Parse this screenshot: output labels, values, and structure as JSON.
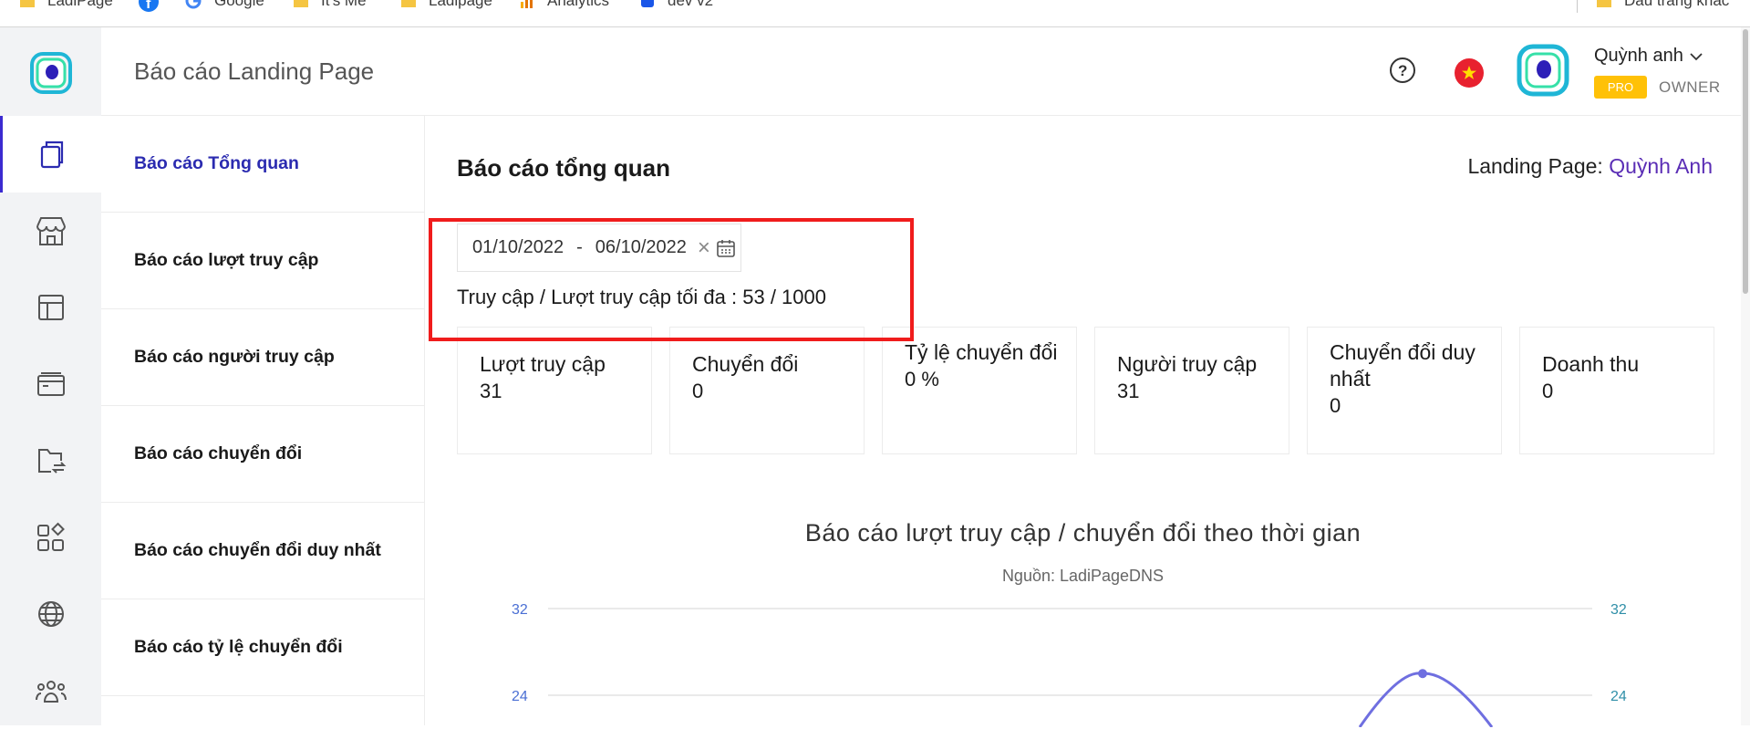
{
  "bookmarks": {
    "items": [
      {
        "label": "LadiPage",
        "icon": "folder-icon"
      },
      {
        "label": "",
        "icon": "facebook-icon"
      },
      {
        "label": "Google",
        "icon": "google-icon"
      },
      {
        "label": "It's Me",
        "icon": "folder-icon"
      },
      {
        "label": "Ladipage",
        "icon": "folder-icon"
      },
      {
        "label": "Analytics",
        "icon": "analytics-icon"
      },
      {
        "label": "dev v2",
        "icon": "app-icon"
      }
    ],
    "other": "Dấu trang khác"
  },
  "header": {
    "title": "Báo cáo Landing Page",
    "user_name": "Quỳnh anh",
    "plan_badge": "PRO",
    "role": "OWNER"
  },
  "rail": {
    "items": [
      {
        "icon": "document-icon",
        "active": true
      },
      {
        "icon": "store-icon",
        "active": false
      },
      {
        "icon": "layout-icon",
        "active": false
      },
      {
        "icon": "browser-icon",
        "active": false
      },
      {
        "icon": "folder-transfer-icon",
        "active": false
      },
      {
        "icon": "apps-icon",
        "active": false
      },
      {
        "icon": "globe-icon",
        "active": false
      },
      {
        "icon": "users-icon",
        "active": false
      }
    ]
  },
  "submenu": {
    "items": [
      {
        "label": "Báo cáo Tổng quan",
        "active": true
      },
      {
        "label": "Báo cáo lượt truy cập",
        "active": false
      },
      {
        "label": "Báo cáo người truy cập",
        "active": false
      },
      {
        "label": "Báo cáo chuyển đổi",
        "active": false
      },
      {
        "label": "Báo cáo chuyển đổi duy nhất",
        "active": false
      },
      {
        "label": "Báo cáo tỷ lệ chuyển đổi",
        "active": false
      }
    ]
  },
  "main": {
    "title": "Báo cáo tổng quan",
    "landing_label": "Landing Page:",
    "landing_name": "Quỳnh Anh",
    "date_from": "01/10/2022",
    "date_sep": "-",
    "date_to": "06/10/2022",
    "quota_text": "Truy cập / Lượt truy cập tối đa : 53 / 1000"
  },
  "stats": [
    {
      "label": "Lượt truy cập",
      "value": "31"
    },
    {
      "label": "Chuyển đổi",
      "value": "0"
    },
    {
      "label": "Tỷ lệ chuyển đổi",
      "value": "0 %"
    },
    {
      "label": "Người truy cập",
      "value": "31"
    },
    {
      "label": "Chuyển đổi duy nhất",
      "value": "0"
    },
    {
      "label": "Doanh thu",
      "value": "0"
    }
  ],
  "chart": {
    "title": "Báo cáo lượt truy cập / chuyển đổi theo thời gian",
    "subtitle": "Nguồn: LadiPageDNS"
  },
  "chart_data": {
    "type": "line",
    "title": "Báo cáo lượt truy cập / chuyển đổi theo thời gian",
    "subtitle": "Nguồn: LadiPageDNS",
    "y_ticks_left": [
      32,
      24
    ],
    "y_ticks_right": [
      32,
      24
    ],
    "ylim": [
      0,
      32
    ],
    "grid": true,
    "series": [
      {
        "color": "#6f6fe0",
        "peak_value": 26
      }
    ]
  },
  "colors": {
    "accent": "#3b2ad0",
    "highlight": "#f01c1c",
    "pro": "#ffc107",
    "line": "#6f6fe0"
  }
}
